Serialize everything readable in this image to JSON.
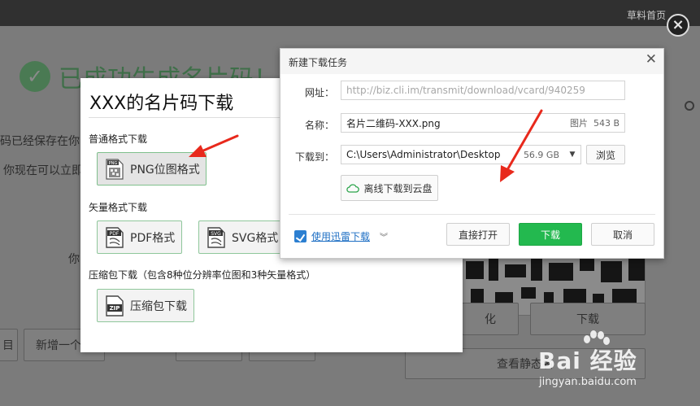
{
  "background_page": {
    "top_link": "草料首页",
    "success_title": "已成功生成名片码！",
    "saved_text": "码已经保存在你",
    "now_text": "你现在可以立即",
    "short_text": "你",
    "edge_text": "目",
    "new_button": "新增一个",
    "action_button_1": "化",
    "download_button": "下载",
    "static_button": "查看静态名"
  },
  "download_panel": {
    "title": "XXX的名片码下载",
    "raster_section": "普通格式下载",
    "png_button": "PNG位图格式",
    "vector_section": "矢量格式下载",
    "pdf_button": "PDF格式",
    "svg_button": "SVG格式",
    "zip_section": "压缩包下载（包含8种位分辨率位图和3种矢量格式）",
    "zip_button": "压缩包下载",
    "icon_labels": {
      "png": "PNG",
      "pdf": "PDF",
      "svg": "SVG",
      "zip": "ZIP"
    }
  },
  "task_dialog": {
    "title": "新建下载任务",
    "url_label": "网址：",
    "url_value": "http://biz.cli.im/transmit/download/vcard/940259",
    "name_label": "名称：",
    "name_value": "名片二维码-XXX.png",
    "file_type": "图片",
    "file_size": "543 B",
    "dest_label": "下载到：",
    "dest_value": "C:\\Users\\Administrator\\Desktop",
    "free_space": "56.9 GB",
    "browse_button": "浏览",
    "cloud_button": "离线下载到云盘",
    "xunlei_link": "使用迅雷下载",
    "open_button": "直接打开",
    "download_button": "下载",
    "cancel_button": "取消"
  },
  "watermark": {
    "logo": "Bai  经验",
    "url": "jingyan.baidu.com"
  },
  "colors": {
    "accent_green": "#23b94f",
    "annotation_red": "#e8291c",
    "link_blue": "#1e6fc4"
  },
  "icons": [
    "close-icon",
    "check-circle-icon",
    "png-file-icon",
    "pdf-file-icon",
    "svg-file-icon",
    "zip-file-icon",
    "cloud-icon",
    "xunlei-icon",
    "chevron-down-icon",
    "baidu-paw-icon"
  ]
}
